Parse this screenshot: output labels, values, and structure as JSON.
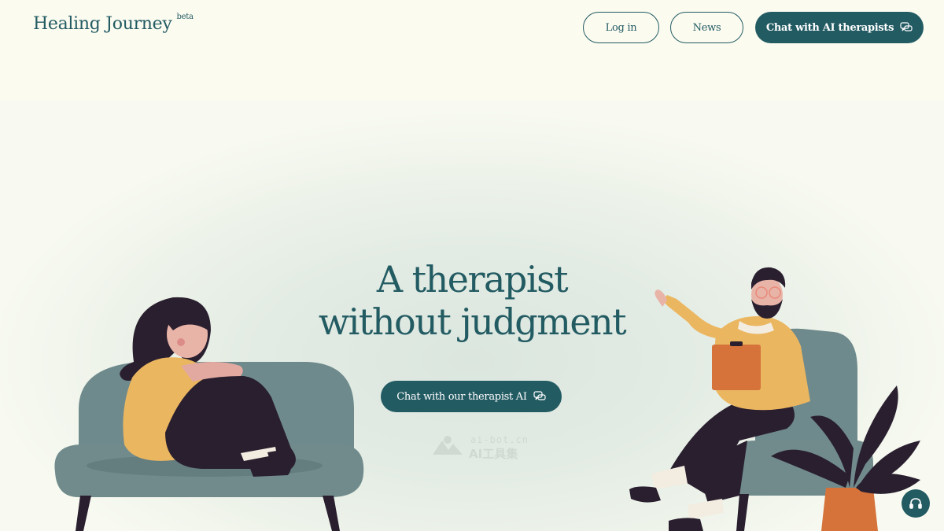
{
  "header": {
    "brand_name": "Healing Journey",
    "brand_badge": "beta",
    "login_label": "Log in",
    "news_label": "News",
    "chat_label": "Chat with AI therapists"
  },
  "hero": {
    "headline_line1": "A therapist",
    "headline_line2": "without judgment",
    "cta_label": "Chat with our therapist AI"
  },
  "watermark": {
    "url": "ai-bot.cn",
    "name": "AI工具集"
  },
  "icons": {
    "chat": "chat-bubbles-icon",
    "support": "headset-icon",
    "watermark_logo": "watermark-logo-icon"
  },
  "colors": {
    "primary": "#235b63",
    "background": "#fbfbf0",
    "sofa": "#6f8a8c",
    "shirt": "#ebb660",
    "dark": "#2a1f2f"
  }
}
